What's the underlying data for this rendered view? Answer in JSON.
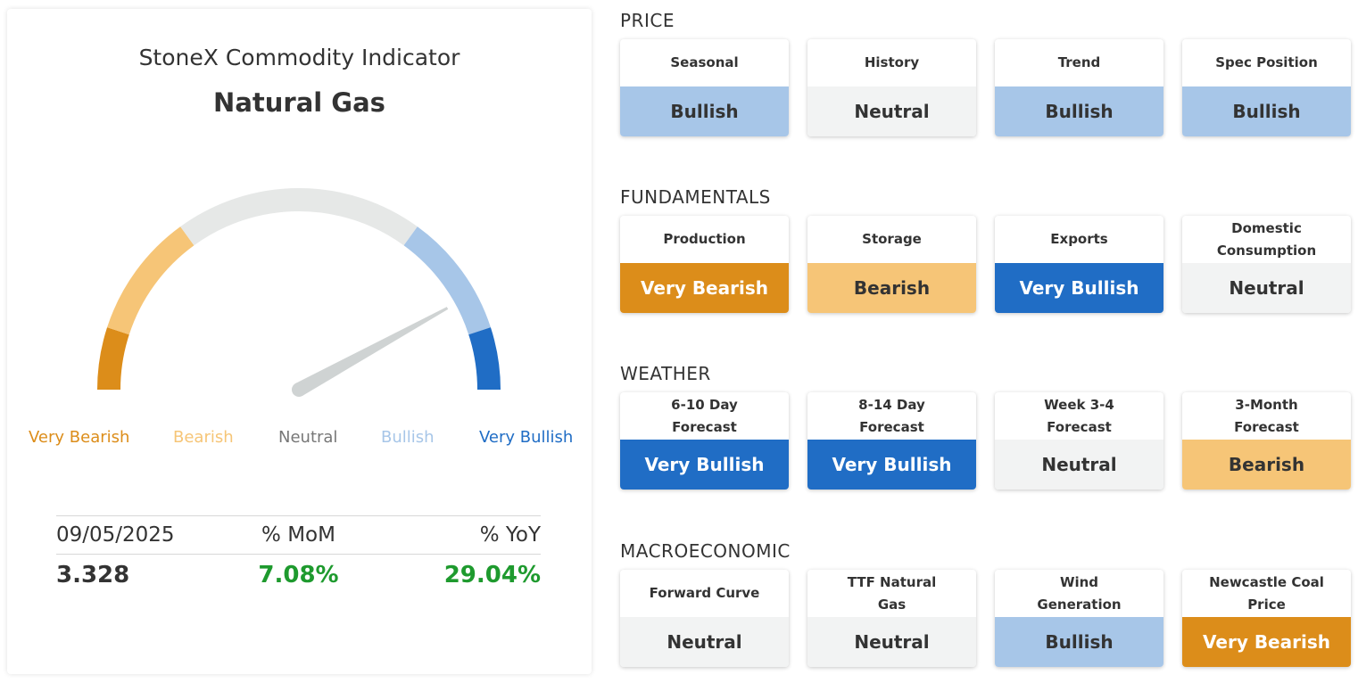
{
  "header": {
    "indicator_title": "StoneX Commodity Indicator",
    "commodity": "Natural Gas"
  },
  "gauge": {
    "labels": [
      "Very Bearish",
      "Bearish",
      "Neutral",
      "Bullish",
      "Very Bullish"
    ],
    "label_colors": [
      "#dc8d1a",
      "#f6c577",
      "#777777",
      "#a7c6e8",
      "#206dc5"
    ],
    "segment_colors": [
      "#dc8d1a",
      "#f6c577",
      "#e6e8e7",
      "#a7c6e8",
      "#206dc5"
    ],
    "needle_color": "#cfd3d3",
    "needle_value": 0.84
  },
  "stats": {
    "date": "09/05/2025",
    "mom_label": "% MoM",
    "yoy_label": "% YoY",
    "price": "3.328",
    "mom": "7.08%",
    "yoy": "29.04%"
  },
  "sections": [
    {
      "title": "PRICE",
      "tiles": [
        {
          "label": "Seasonal",
          "value": "Bullish",
          "class": "v-bullish"
        },
        {
          "label": "History",
          "value": "Neutral",
          "class": "v-neutral"
        },
        {
          "label": "Trend",
          "value": "Bullish",
          "class": "v-bullish"
        },
        {
          "label": "Spec Position",
          "value": "Bullish",
          "class": "v-bullish"
        }
      ]
    },
    {
      "title": "FUNDAMENTALS",
      "tiles": [
        {
          "label": "Production",
          "value": "Very Bearish",
          "class": "v-very-bearish"
        },
        {
          "label": "Storage",
          "value": "Bearish",
          "class": "v-bearish"
        },
        {
          "label": "Exports",
          "value": "Very Bullish",
          "class": "v-very-bullish"
        },
        {
          "label": "Domestic Consumption",
          "value": "Neutral",
          "class": "v-neutral"
        }
      ]
    },
    {
      "title": "WEATHER",
      "tiles": [
        {
          "label": "6-10 Day Forecast",
          "value": "Very Bullish",
          "class": "v-very-bullish"
        },
        {
          "label": "8-14 Day Forecast",
          "value": "Very Bullish",
          "class": "v-very-bullish"
        },
        {
          "label": "Week 3-4 Forecast",
          "value": "Neutral",
          "class": "v-neutral"
        },
        {
          "label": "3-Month Forecast",
          "value": "Bearish",
          "class": "v-bearish"
        }
      ]
    },
    {
      "title": "MACROECONOMIC",
      "tiles": [
        {
          "label": "Forward Curve",
          "value": "Neutral",
          "class": "v-neutral"
        },
        {
          "label": "TTF Natural Gas",
          "value": "Neutral",
          "class": "v-neutral"
        },
        {
          "label": "Wind Generation",
          "value": "Bullish",
          "class": "v-bullish"
        },
        {
          "label": "Newcastle Coal Price",
          "value": "Very Bearish",
          "class": "v-very-bearish"
        }
      ]
    }
  ]
}
